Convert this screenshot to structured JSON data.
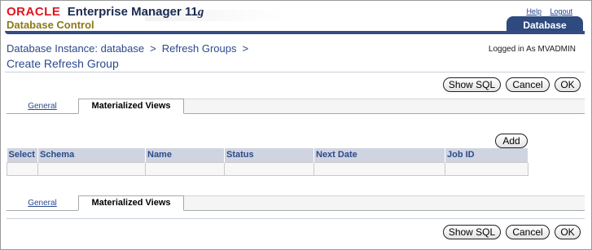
{
  "branding": {
    "oracle": "ORACLE",
    "product": "Enterprise Manager 11",
    "version_suffix": "g",
    "subtitle": "Database Control"
  },
  "global_links": {
    "help": "Help",
    "logout": "Logout"
  },
  "top_tab": {
    "label": "Database"
  },
  "breadcrumb": {
    "items": [
      "Database Instance: database",
      "Refresh Groups"
    ],
    "separator": ">"
  },
  "user_info": "Logged in As MVADMIN",
  "page_title": "Create Refresh Group",
  "buttons": {
    "show_sql": "Show SQL",
    "cancel": "Cancel",
    "ok": "OK",
    "add": "Add"
  },
  "subtabs": {
    "general": "General",
    "materialized_views": "Materialized Views",
    "active": "Materialized Views"
  },
  "table": {
    "columns": [
      "Select",
      "Schema",
      "Name",
      "Status",
      "Next Date",
      "Job ID"
    ],
    "rows": []
  },
  "colors": {
    "brand_red": "#e0161c",
    "bar_blue": "#334d82",
    "link_blue": "#2b4a8c",
    "table_header_bg": "#cfd4e0",
    "subtitle_olive": "#8a7a1a"
  }
}
